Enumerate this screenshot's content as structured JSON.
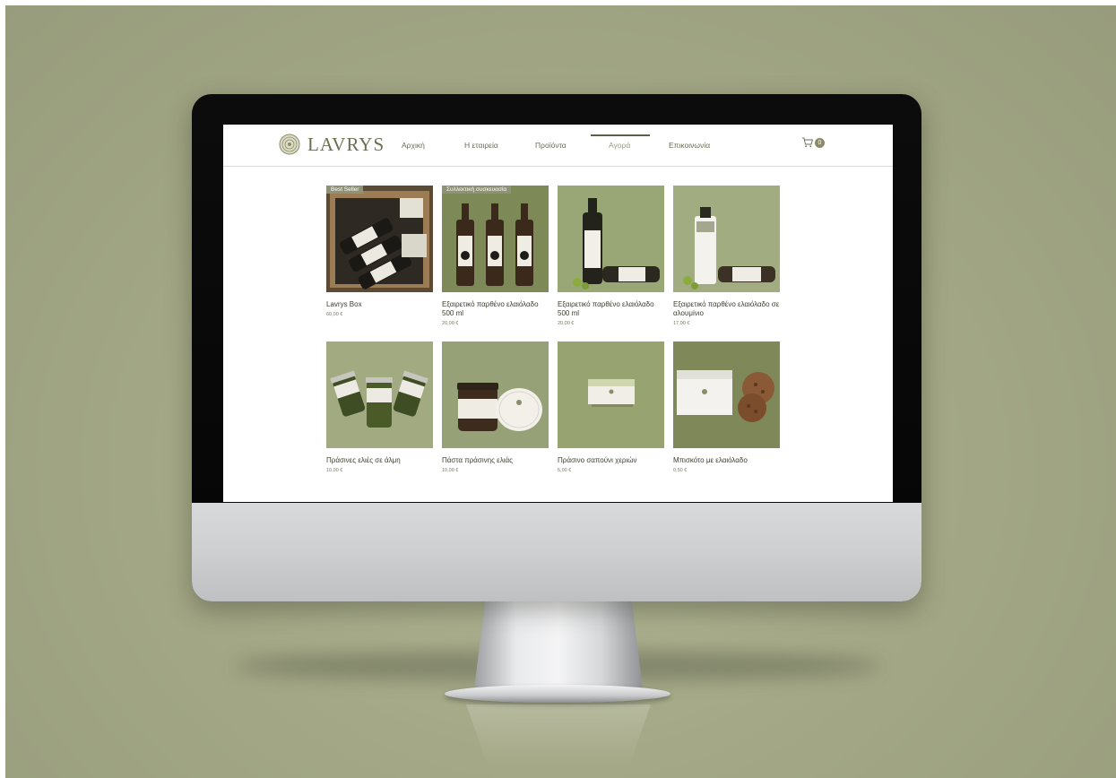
{
  "site": {
    "brand": "LAVRYS"
  },
  "nav": {
    "items": [
      {
        "label": "Αρχική"
      },
      {
        "label": "Η εταιρεία"
      },
      {
        "label": "Προϊόντα"
      },
      {
        "label": "Αγορά",
        "active": true
      },
      {
        "label": "Επικοινωνία"
      }
    ]
  },
  "cart": {
    "count": "0"
  },
  "products": [
    {
      "name": "Lavrys Box",
      "price": "60,00 €",
      "ribbon": "Best Seller",
      "image": "gift-box-with-bottles"
    },
    {
      "name": "Εξαιρετικό παρθένο ελαιόλαδο 500 ml",
      "price": "20,00 €",
      "ribbon": "Συλλεκτική συσκευασία",
      "image": "three-dark-bottles"
    },
    {
      "name": "Εξαιρετικό παρθένο ελαιόλαδο 500 ml",
      "price": "20,00 €",
      "ribbon": "",
      "image": "glass-bottle-standing-and-lying"
    },
    {
      "name": "Εξαιρετικό παρθένο ελαιόλαδο σε αλουμίνιο",
      "price": "17,00 €",
      "ribbon": "",
      "image": "aluminium-bottle-standing-and-lying"
    },
    {
      "name": "Πράσινες ελιές σε άλμη",
      "price": "10,00 €",
      "ribbon": "",
      "image": "three-olive-jars"
    },
    {
      "name": "Πάστα πράσινης ελιάς",
      "price": "10,00 €",
      "ribbon": "",
      "image": "paste-jar-and-lid"
    },
    {
      "name": "Πράσινο σαπούνι χεριών",
      "price": "5,00 €",
      "ribbon": "",
      "image": "soap-bar"
    },
    {
      "name": "Μπισκότο με ελαιόλαδο",
      "price": "0,50 €",
      "ribbon": "",
      "image": "cookie-pack-and-cookies"
    }
  ],
  "colors": {
    "background": "#a4a886",
    "brand_olive": "#6e6e50",
    "product_bg_light": "#9fa67a",
    "product_bg_dark": "#7f8a57",
    "ribbon": "#8f9276"
  }
}
